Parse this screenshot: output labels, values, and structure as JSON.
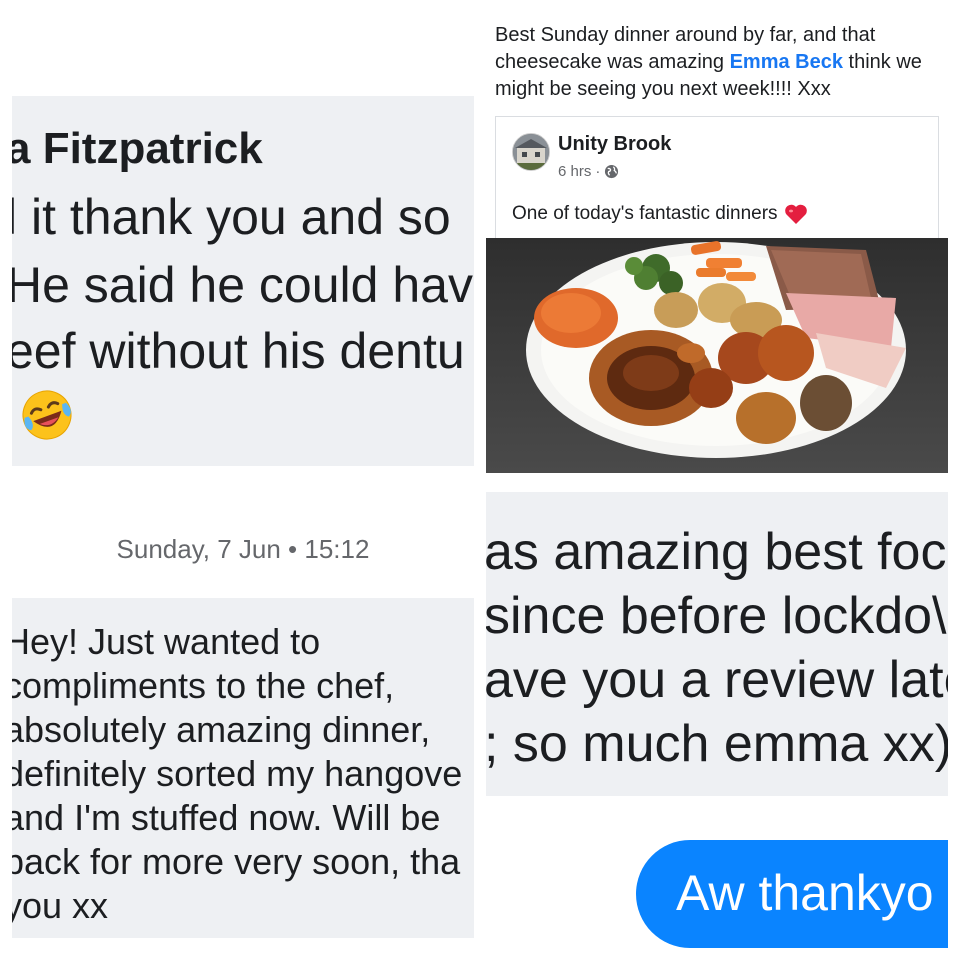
{
  "panel_top_left": {
    "name": "a Fitzpatrick",
    "lines": [
      "l it thank you and so",
      "He said he could hav",
      "eef without his dentu"
    ],
    "emoji": "laughing-crying-emoji"
  },
  "panel_top_right": {
    "post_text_before": "Best Sunday dinner around by far, and that cheesecake was amazing ",
    "mention": "Emma Beck",
    "post_text_after": " think we might be seeing you next week!!!! Xxx",
    "shared_post": {
      "author": "Unity Brook",
      "time": "6 hrs",
      "separator": "·",
      "privacy_icon": "globe-icon",
      "caption": "One of today's fantastic dinners",
      "caption_icon": "red-heart-icon"
    }
  },
  "panel_bottom_left": {
    "date": "Sunday, 7 Jun • 15:12",
    "message_lines": [
      "Hey! Just wanted to",
      "compliments to the chef,",
      "absolutely amazing dinner,",
      "definitely sorted my hangove",
      "and I'm stuffed now. Will be",
      "back for more very soon, tha",
      "you xx"
    ]
  },
  "panel_bottom_right": {
    "lines": [
      "as amazing best foc",
      "since before lockdo\\",
      "ave you a review late",
      "; so much emma xx)"
    ],
    "reply": "Aw thankyo"
  },
  "colors": {
    "mention_blue": "#1877f2",
    "bubble_blue": "#0a84ff",
    "quoted_bg": "#eef0f3",
    "meta_gray": "#65676b",
    "heart_red": "#e41e3f"
  }
}
